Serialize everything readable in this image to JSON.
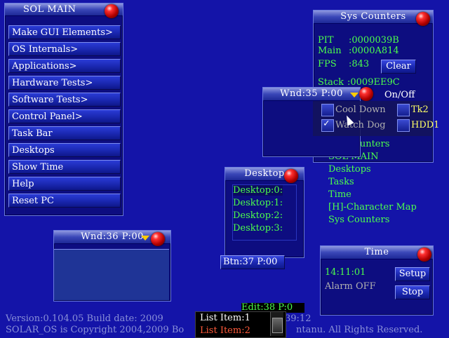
{
  "sol_main": {
    "title": "SOL MAIN",
    "items": [
      {
        "label": "Make GUI Elements>"
      },
      {
        "label": "OS Internals>"
      },
      {
        "label": "Applications>"
      },
      {
        "label": "Hardware Tests>"
      },
      {
        "label": "Software Tests>"
      },
      {
        "label": "Control Panel>"
      },
      {
        "label": "Task Bar"
      },
      {
        "label": "Desktops"
      },
      {
        "label": "Show Time"
      },
      {
        "label": "Help"
      },
      {
        "label": "Reset PC"
      }
    ]
  },
  "sys_counters": {
    "title": "Sys Counters",
    "pit_label": "PIT",
    "pit_value": ":0000039B",
    "main_label": "Main",
    "main_value": ":0000A814",
    "fps_label": "FPS",
    "fps_value": ":843",
    "clear_label": "Clear",
    "stack_label": "Stack",
    "stack_value": ":0009EE9C"
  },
  "toggles": {
    "header": "On/Off",
    "items": [
      {
        "label": "Cool Down",
        "checked": false
      },
      {
        "label": "Watch Dog",
        "checked": true
      }
    ],
    "tk2_label": "Tk2",
    "hdd1_label": "HDD1"
  },
  "list_links": [
    {
      "label": "Sys Counters"
    },
    {
      "label": "SOL MAIN"
    },
    {
      "label": "Desktops"
    },
    {
      "label": "Tasks"
    },
    {
      "label": "Time"
    },
    {
      "label": "[H]-Character Map"
    },
    {
      "label": "Sys Counters"
    }
  ],
  "wnd35": {
    "title": "Wnd:35 P:00"
  },
  "wnd36": {
    "title": "Wnd:36 P:00"
  },
  "desktop_win": {
    "title": "Desktop",
    "items": [
      {
        "label": "Desktop:0:"
      },
      {
        "label": "Desktop:1:"
      },
      {
        "label": "Desktop:2:"
      },
      {
        "label": "Desktop:3:"
      }
    ],
    "btn_label": "Btn:37 P:00"
  },
  "time_win": {
    "title": "Time",
    "clock": "14:11:01",
    "alarm": "Alarm OFF",
    "setup_label": "Setup",
    "stop_label": "Stop"
  },
  "edit_label": "Edit:38 P:0",
  "list_popup": {
    "items": [
      {
        "label": "List Item:1"
      },
      {
        "label": "List Item:2"
      }
    ]
  },
  "footer": {
    "version": "Version:0.104.05  Build date: 2009",
    "time_suffix": "39:12",
    "copyright_left": "SOLAR_OS is Copyright 2004,2009 Bo",
    "copyright_right": "ntanu. All Rights Reserved."
  },
  "colors": {
    "desktop_bg": "#1414a8",
    "window_bg": "#0d0d80",
    "green_text": "#4cff4c",
    "title_red_orb": "#ff3030",
    "highlight_text": "#ffff66",
    "list_item_2": "#ff5a3a"
  }
}
